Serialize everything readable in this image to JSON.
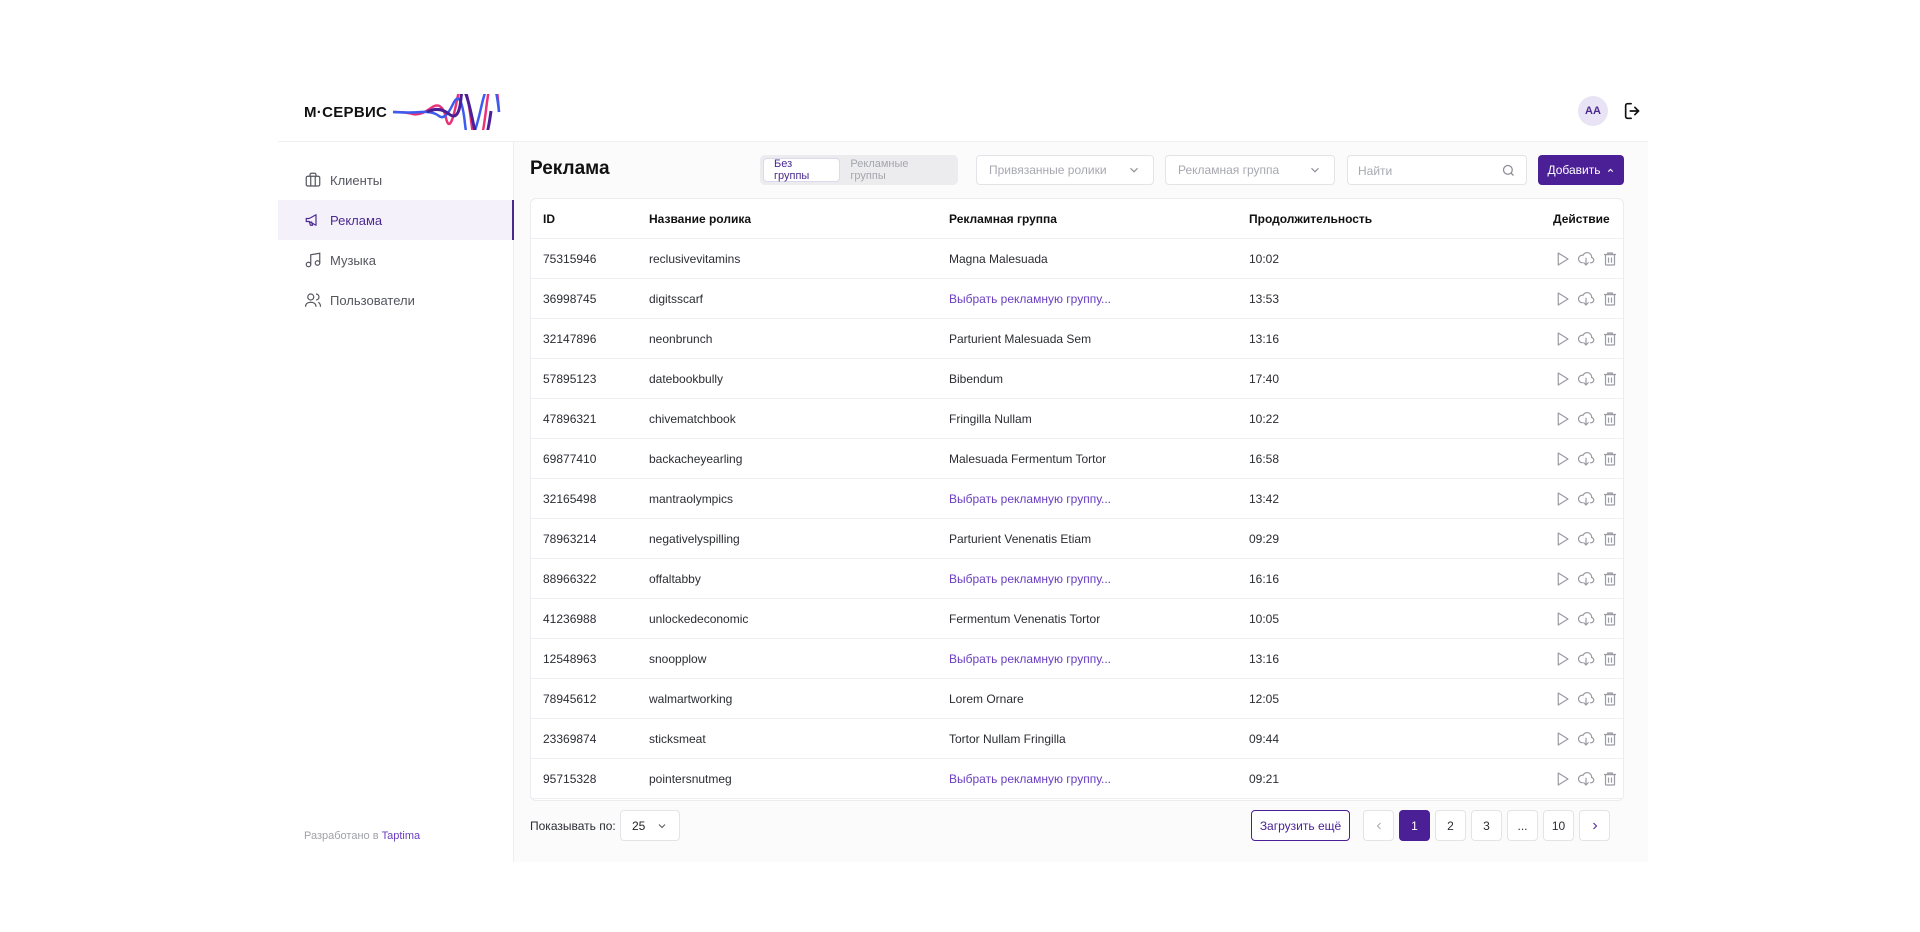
{
  "header": {
    "logo_text": "М·СЕРВИС",
    "avatar_initials": "АА"
  },
  "sidebar": {
    "items": [
      {
        "label": "Клиенты",
        "icon": "briefcase-icon"
      },
      {
        "label": "Реклама",
        "icon": "megaphone-icon",
        "active": true
      },
      {
        "label": "Музыка",
        "icon": "music-note-icon"
      },
      {
        "label": "Пользователи",
        "icon": "users-icon"
      }
    ],
    "footer_prefix": "Разработано в ",
    "footer_brand": "Taptima"
  },
  "toolbar": {
    "title": "Реклама",
    "segments": [
      "Без группы",
      "Рекламные группы"
    ],
    "linked_videos_placeholder": "Привязанные ролики",
    "ad_group_placeholder": "Рекламная группа",
    "search_placeholder": "Найти",
    "add_label": "Добавить"
  },
  "table": {
    "columns": [
      "ID",
      "Название ролика",
      "Рекламная группа",
      "Продолжительность",
      "Действие"
    ],
    "rows": [
      {
        "id": "75315946",
        "name": "reclusivevitamins",
        "group": "Magna Malesuada",
        "group_is_link": false,
        "duration": "10:02"
      },
      {
        "id": "36998745",
        "name": "digitsscarf",
        "group": "Выбрать рекламную группу...",
        "group_is_link": true,
        "duration": "13:53"
      },
      {
        "id": "32147896",
        "name": "neonbrunch",
        "group": "Parturient Malesuada Sem",
        "group_is_link": false,
        "duration": "13:16"
      },
      {
        "id": "57895123",
        "name": "datebookbully",
        "group": "Bibendum",
        "group_is_link": false,
        "duration": "17:40"
      },
      {
        "id": "47896321",
        "name": "chivematchbook",
        "group": "Fringilla Nullam",
        "group_is_link": false,
        "duration": "10:22"
      },
      {
        "id": "69877410",
        "name": "backacheyearling",
        "group": "Malesuada Fermentum Tortor",
        "group_is_link": false,
        "duration": "16:58"
      },
      {
        "id": "32165498",
        "name": "mantraolympics",
        "group": "Выбрать рекламную группу...",
        "group_is_link": true,
        "duration": "13:42"
      },
      {
        "id": "78963214",
        "name": "negativelyspilling",
        "group": "Parturient Venenatis Etiam",
        "group_is_link": false,
        "duration": "09:29"
      },
      {
        "id": "88966322",
        "name": "offaltabby",
        "group": "Выбрать рекламную группу...",
        "group_is_link": true,
        "duration": "16:16"
      },
      {
        "id": "41236988",
        "name": "unlockedeconomic",
        "group": "Fermentum Venenatis Tortor",
        "group_is_link": false,
        "duration": "10:05"
      },
      {
        "id": "12548963",
        "name": "snoopplow",
        "group": "Выбрать рекламную группу...",
        "group_is_link": true,
        "duration": "13:16"
      },
      {
        "id": "78945612",
        "name": "walmartworking",
        "group": "Lorem Ornare",
        "group_is_link": false,
        "duration": "12:05"
      },
      {
        "id": "23369874",
        "name": "sticksmeat",
        "group": "Tortor Nullam Fringilla",
        "group_is_link": false,
        "duration": "09:44"
      },
      {
        "id": "95715328",
        "name": "pointersnutmeg",
        "group": "Выбрать рекламную группу...",
        "group_is_link": true,
        "duration": "09:21"
      }
    ]
  },
  "pagination": {
    "per_page_label": "Показывать по:",
    "per_page_value": "25",
    "load_more_label": "Загрузить ещё",
    "pages": [
      "1",
      "2",
      "3",
      "...",
      "10"
    ],
    "current_page": "1"
  },
  "colors": {
    "accent": "#4b1f96",
    "link": "#6a3fc0",
    "active_nav_bg": "#f4f1fb"
  }
}
